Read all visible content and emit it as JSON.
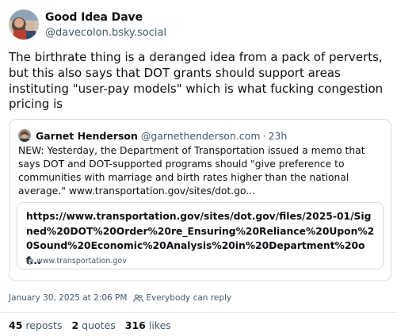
{
  "author": {
    "display_name": "Good Idea Dave",
    "handle": "@davecolon.bsky.social"
  },
  "post": {
    "text": "The birthrate thing is a deranged idea from a pack of perverts, but this also says that DOT grants should support areas instituting \"user-pay models\" which is what fucking congestion pricing is"
  },
  "quote": {
    "display_name": "Garnet Henderson",
    "handle": "@garnethenderson.com",
    "separator": "·",
    "time": "23h",
    "text": "NEW: Yesterday, the Department of Transportation issued a memo that says DOT and DOT-supported programs should \"give preference to communities with marriage and birth rates higher than the national average.\" www.transportation.gov/sites/dot.go...",
    "link_card": {
      "title": "https://www.transportation.gov/sites/dot.gov/files/2025-01/Signed%20DOT%20Order%20re_Ensuring%20Reliance%20Upon%20Sound%20Economic%20Analysis%20in%20Department%20of...",
      "domain": "www.transportation.gov"
    }
  },
  "meta": {
    "timestamp": "January 30, 2025 at 2:06 PM",
    "reply_setting": "Everybody can reply"
  },
  "stats": {
    "reposts_count": "45",
    "reposts_label": "reposts",
    "quotes_count": "2",
    "quotes_label": "quotes",
    "likes_count": "316",
    "likes_label": "likes"
  },
  "colors": {
    "text_primary": "#0b0f14",
    "text_secondary": "#42576c",
    "border": "#d4dbe2"
  },
  "icons": {
    "link_domain": "globe-icon",
    "reply_setting": "people-icon"
  }
}
